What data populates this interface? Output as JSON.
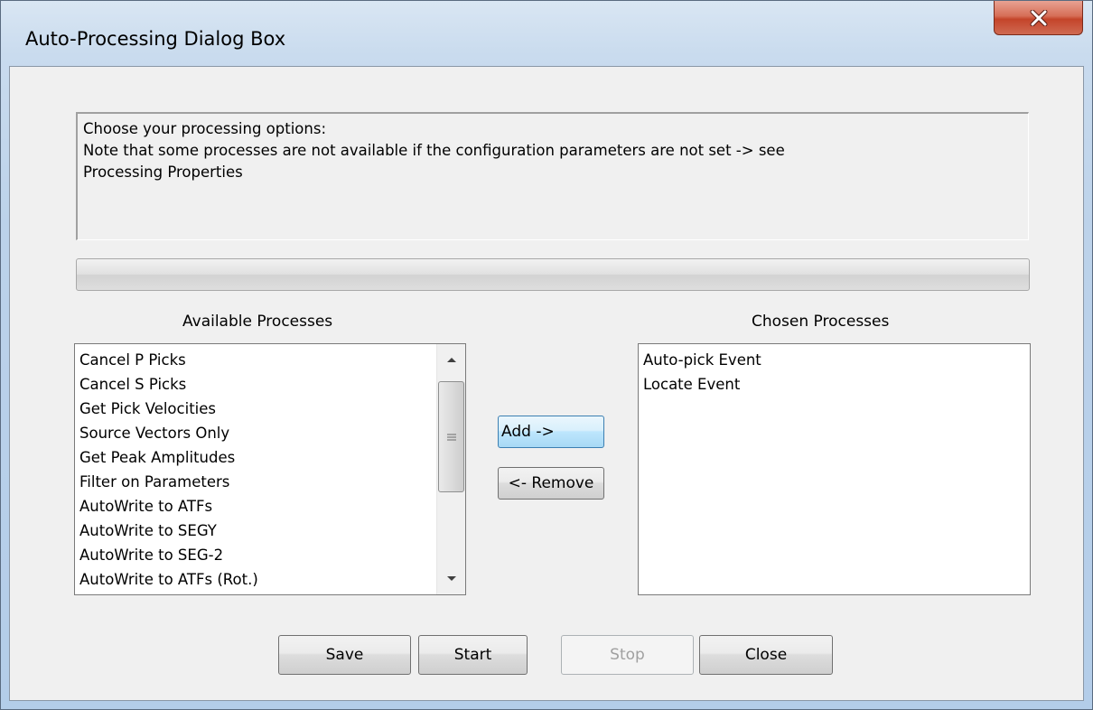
{
  "window": {
    "title": "Auto-Processing Dialog Box",
    "close_icon": "close-icon"
  },
  "note": {
    "lines": [
      "Choose your processing options:",
      "Note that some processes are not available if the configuration parameters are not set -> see",
      "Processing Properties"
    ]
  },
  "progress": {
    "value": 0
  },
  "available": {
    "label": "Available Processes",
    "items": [
      "Cancel P Picks",
      "Cancel S Picks",
      "Get Pick Velocities",
      "Source Vectors Only",
      "Get Peak Amplitudes",
      "Filter on Parameters",
      "AutoWrite to ATFs",
      "AutoWrite to SEGY",
      "AutoWrite to SEG-2",
      "AutoWrite to ATFs (Rot.)"
    ]
  },
  "chosen": {
    "label": "Chosen Processes",
    "items": [
      "Auto-pick Event",
      "Locate Event"
    ]
  },
  "buttons": {
    "add": "Add ->",
    "remove": "<- Remove",
    "save": "Save",
    "start": "Start",
    "stop": "Stop",
    "close": "Close"
  },
  "colors": {
    "close_button": "#c4442a",
    "dialog_face": "#f0f0f0",
    "focus_border": "#3c7fb1"
  }
}
